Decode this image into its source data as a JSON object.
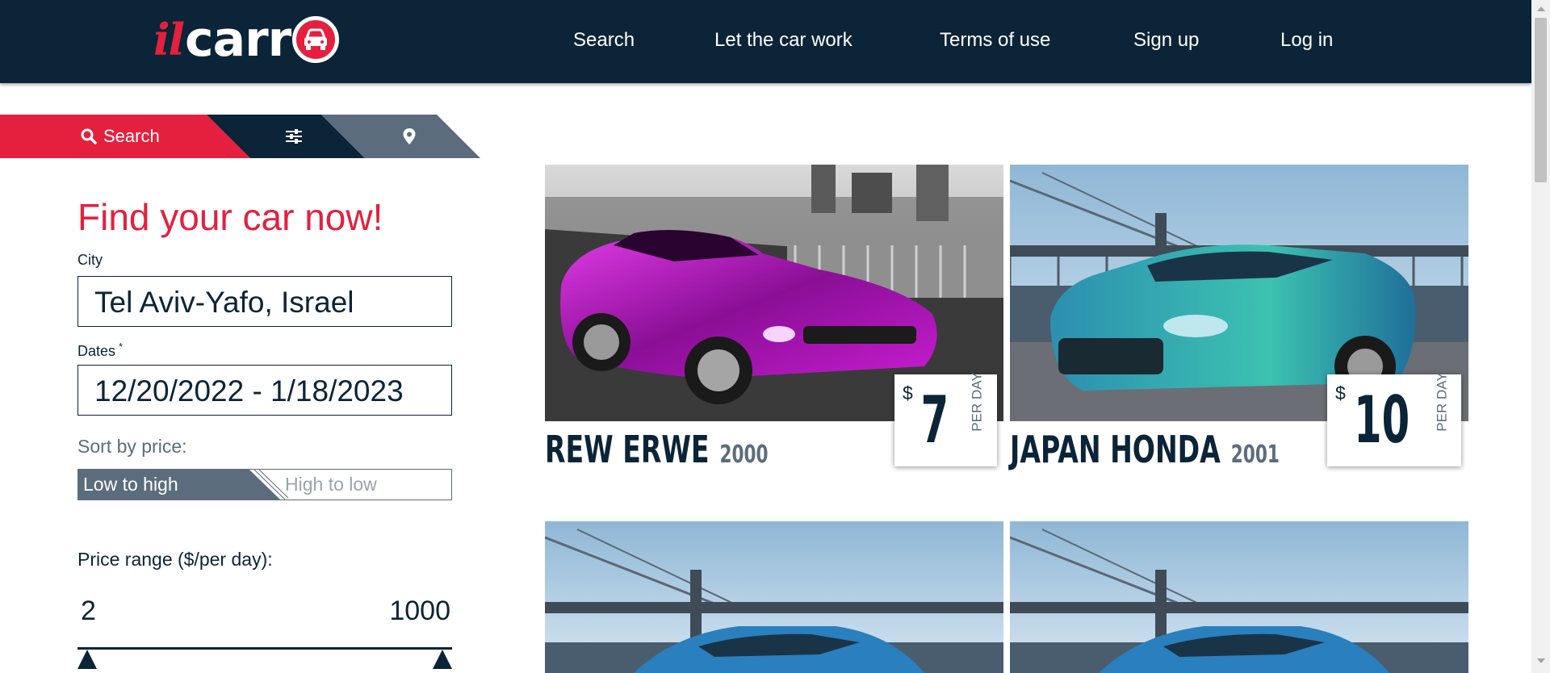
{
  "app": {
    "logo_il": "il",
    "logo_car": "carr",
    "brand_color": "#e4203e",
    "navy_color": "#0b2437",
    "slate_color": "#5b6d7c"
  },
  "nav": {
    "items": [
      {
        "label": "Search"
      },
      {
        "label": "Let the car work"
      },
      {
        "label": "Terms of use"
      },
      {
        "label": "Sign up"
      },
      {
        "label": "Log in"
      }
    ]
  },
  "tabs": {
    "search_label": "Search",
    "search_icon": "search-icon",
    "filters_icon": "sliders-icon",
    "map_icon": "map-pin-icon"
  },
  "form": {
    "title": "Find your car now!",
    "city_label": "City",
    "city_value": "Tel Aviv-Yafo, Israel",
    "dates_label": "Dates",
    "dates_required": "*",
    "dates_value": "12/20/2022 - 1/18/2023",
    "sort_label": "Sort by price:",
    "sort_low": "Low to high",
    "sort_high": "High to low",
    "sort_selected": "Low to high",
    "price_range_label": "Price range ($/per day):",
    "price_min": "2",
    "price_max": "1000"
  },
  "cars": [
    {
      "name": "REW ERWE",
      "year": "2000",
      "currency": "$",
      "price": "7",
      "per": "PER DAY",
      "image": "purple-camaro"
    },
    {
      "name": "JAPAN HONDA",
      "year": "2001",
      "currency": "$",
      "price": "10",
      "per": "PER DAY",
      "image": "teal-sedan"
    },
    {
      "image": "blue-sedan"
    },
    {
      "image": "blue-sedan"
    }
  ]
}
